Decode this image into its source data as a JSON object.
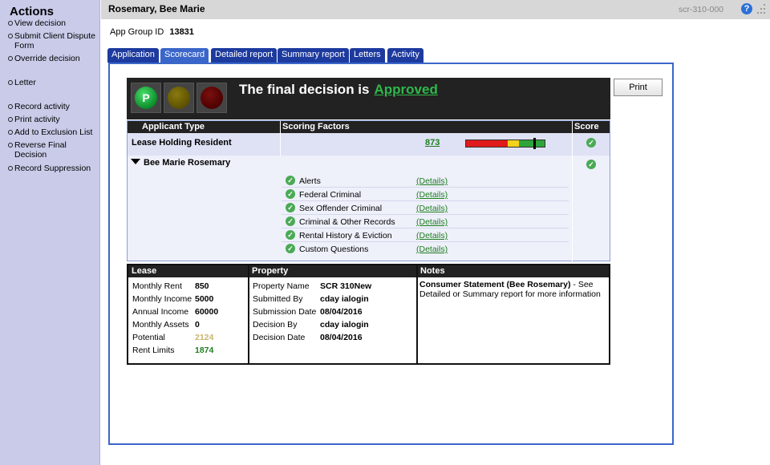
{
  "sidebar": {
    "title": "Actions",
    "items": [
      {
        "label": "View decision"
      },
      {
        "label": "Submit Client Dispute Form"
      },
      {
        "label": "Override decision"
      },
      {
        "label": "Letter"
      },
      {
        "label": "Record activity"
      },
      {
        "label": "Print activity"
      },
      {
        "label": "Add to Exclusion List"
      },
      {
        "label": "Reverse Final Decision"
      },
      {
        "label": "Record Suppression"
      }
    ]
  },
  "header": {
    "name": "Rosemary, Bee Marie",
    "screen_code": "scr-310-000",
    "help_icon": "question-circle-icon",
    "resize_icon": "resize-grip-icon"
  },
  "app_group": {
    "label": "App Group ID",
    "value": "13831"
  },
  "tabs": [
    {
      "label": "Application"
    },
    {
      "label": "Scorecard",
      "active": true
    },
    {
      "label": "Detailed report"
    },
    {
      "label": "Summary report"
    },
    {
      "label": "Letters"
    },
    {
      "label": "Activity"
    }
  ],
  "decision": {
    "prefix": "The final decision is",
    "result": "Approved",
    "light_label": "P",
    "lights": [
      "green",
      "yellow",
      "red"
    ],
    "result_color": "#2fb84a"
  },
  "print_label": "Print",
  "scorecard": {
    "headers": {
      "applicant_type": "Applicant Type",
      "scoring_factors": "Scoring Factors",
      "score": "Score"
    },
    "row": {
      "applicant_type": "Lease Holding Resident",
      "score": "873"
    },
    "gauge_level": 0.87,
    "applicant_name": "Bee Marie Rosemary",
    "factors": [
      {
        "name": "Alerts",
        "detail": "(Details)"
      },
      {
        "name": "Federal Criminal",
        "detail": "(Details)"
      },
      {
        "name": "Sex Offender Criminal",
        "detail": "(Details)"
      },
      {
        "name": "Criminal & Other Records",
        "detail": "(Details)"
      },
      {
        "name": "Rental History & Eviction",
        "detail": "(Details)"
      },
      {
        "name": "Custom Questions",
        "detail": "(Details)"
      }
    ]
  },
  "lease": {
    "title": "Lease",
    "rows": [
      {
        "label": "Monthly Rent",
        "value": "850"
      },
      {
        "label": "Monthly Income",
        "value": "5000"
      },
      {
        "label": "Annual Income",
        "value": "60000"
      },
      {
        "label": "Monthly Assets",
        "value": "0"
      },
      {
        "label": "Potential",
        "value": "2124"
      },
      {
        "label": "Rent Limits",
        "value": "1874"
      }
    ]
  },
  "property": {
    "title": "Property",
    "rows": [
      {
        "label": "Property Name",
        "value": "SCR 310New"
      },
      {
        "label": "Submitted By",
        "value": "cday ialogin"
      },
      {
        "label": "Submission Date",
        "value": "08/04/2016"
      },
      {
        "label": "Decision By",
        "value": "cday ialogin"
      },
      {
        "label": "Decision Date",
        "value": "08/04/2016"
      }
    ]
  },
  "notes": {
    "title": "Notes",
    "bold_text": "Consumer Statement (Bee Rosemary)",
    "text": " - See Detailed or Summary report for more information"
  },
  "colors": {
    "sidebar_bg": "#c9cbe9",
    "tab_bg": "#1d3a9e",
    "tab_active_bg": "#3b66c9",
    "link_green": "#1e7d20",
    "potential_color": "#c9b56a",
    "rent_limits_color": "#1e7d20"
  }
}
